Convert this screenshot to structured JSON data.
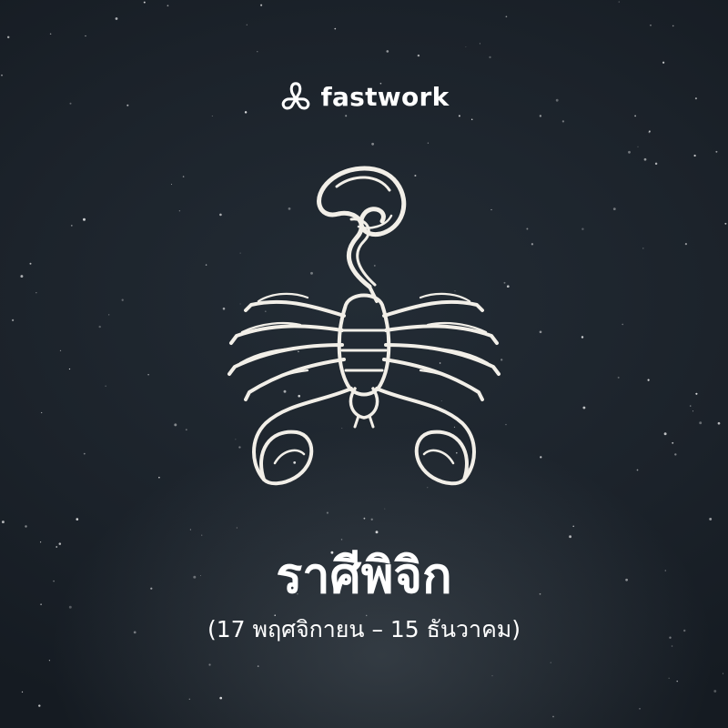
{
  "brand": {
    "name": "fastwork",
    "icon": "fastwork-logo-icon"
  },
  "zodiac": {
    "title": "ราศีพิจิก",
    "date_range": "(17 พฤศจิกายน – 15 ธันวาคม)",
    "illustration": "scorpion-icon"
  },
  "colors": {
    "background": "#1c232b",
    "text": "#ffffff",
    "illustration": "#f2efe8"
  }
}
